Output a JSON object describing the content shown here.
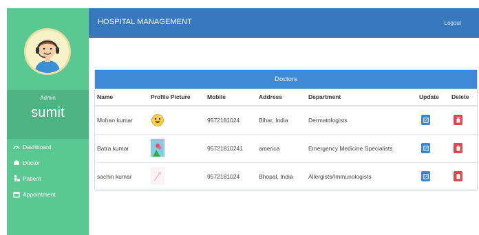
{
  "header": {
    "title": "HOSPITAL MANAGEMENT",
    "logout_label": "Logout"
  },
  "sidebar": {
    "role_label": "Admin",
    "user_name": "sumit",
    "items": [
      {
        "label": "Dashboard",
        "icon": "dashboard-icon"
      },
      {
        "label": "Doctor",
        "icon": "bed-icon"
      },
      {
        "label": "Patient",
        "icon": "patient-icon"
      },
      {
        "label": "Appointment",
        "icon": "calendar-icon"
      }
    ]
  },
  "doctors_panel": {
    "title": "Doctors",
    "columns": [
      "Name",
      "Profile Picture",
      "Mobile",
      "Address",
      "Department",
      "Update",
      "Delete"
    ],
    "rows": [
      {
        "name": "Mohan kumar",
        "picture": "smiley-face",
        "mobile": "9572181024",
        "address": "Bihar, India",
        "department": "Dermatologists"
      },
      {
        "name": "Batra kumar",
        "picture": "photo-thumbnail",
        "mobile": "95721810241",
        "address": "america",
        "department": "Emergency Medicine Specialists"
      },
      {
        "name": "sachin kumar",
        "picture": "faded-thumbnail",
        "mobile": "9572181024",
        "address": "Bhopal, India",
        "department": "Allergists/Immunologists"
      }
    ]
  },
  "colors": {
    "sidebar": "#5bc792",
    "header": "#3879bd",
    "panel_heading": "#3f89d6",
    "update": "#3a86d0",
    "delete": "#d64c4c"
  }
}
